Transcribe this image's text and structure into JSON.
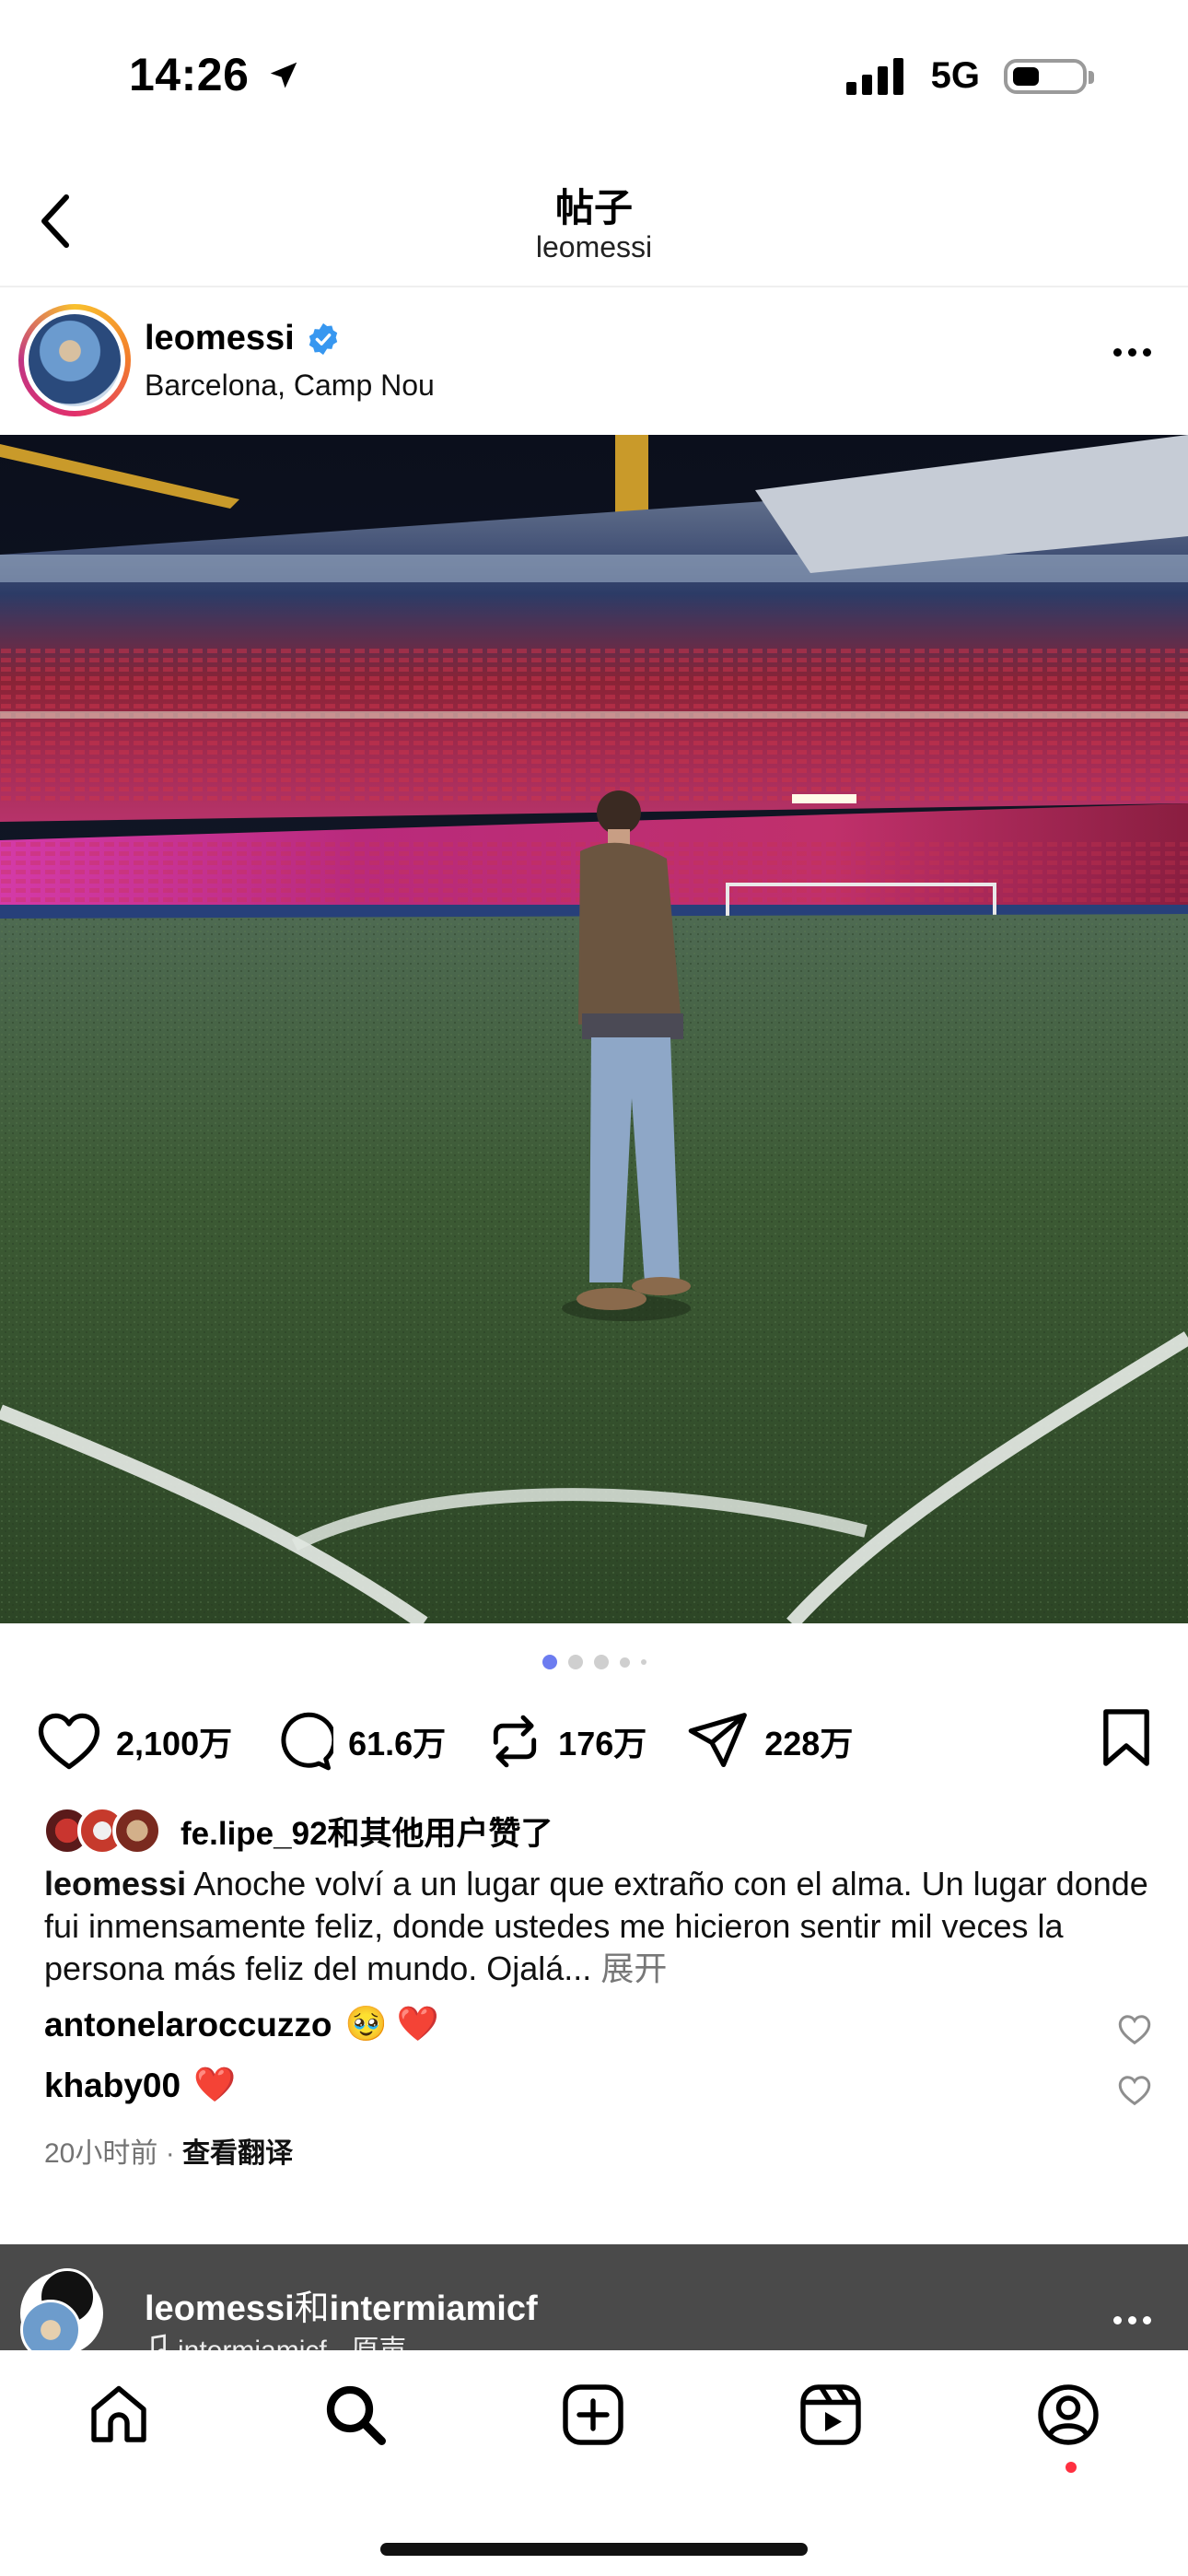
{
  "status_bar": {
    "time": "14:26",
    "network": "5G"
  },
  "header": {
    "title": "帖子",
    "subtitle": "leomessi"
  },
  "post": {
    "username": "leomessi",
    "verified": true,
    "location": "Barcelona, Camp Nou",
    "carousel": {
      "count": 5,
      "active_index": 0
    },
    "actions": {
      "likes": "2,100万",
      "comments": "61.6万",
      "reposts": "176万",
      "shares": "228万"
    },
    "liked_by": {
      "name": "fe.lipe_92",
      "suffix": "和其他用户赞了"
    },
    "caption": {
      "username": "leomessi",
      "text": "Anoche volví a un lugar que extraño con el alma. Un lugar donde fui inmensamente feliz, donde ustedes me hicieron sentir mil veces la persona más feliz del mundo. Ojalá...",
      "more_label": "展开"
    },
    "comments": [
      {
        "username": "antonelaroccuzzo",
        "text": "🥹 ❤️"
      },
      {
        "username": "khaby00",
        "text": "❤️"
      }
    ],
    "time_ago": "20小时前",
    "translate_label": "查看翻译"
  },
  "next_post": {
    "username": "leomessi",
    "connector": "和",
    "collaborator": "intermiamicf",
    "audio": "intermiamicf · 原声"
  },
  "tabbar": {
    "items": [
      "home-icon",
      "search-icon",
      "create-icon",
      "reels-icon",
      "profile-icon"
    ],
    "active": "search-icon"
  },
  "colors": {
    "verified_blue": "#3797f0",
    "notification_red": "#ff3040",
    "active_dot": "#6c7cf0"
  }
}
